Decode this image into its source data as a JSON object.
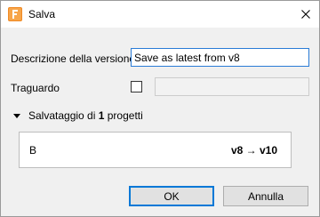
{
  "window": {
    "title": "Salva",
    "icon": "fusion-app-icon",
    "close_icon": "close-icon"
  },
  "form": {
    "description_label": "Descrizione della versione",
    "description_value": "Save as latest from v8",
    "milestone_label": "Traguardo",
    "milestone_checked": false,
    "milestone_value": ""
  },
  "section": {
    "prefix": "Salvataggio di ",
    "count": "1",
    "suffix": " progetti",
    "expanded": true
  },
  "projects": [
    {
      "name": "B",
      "version": "v8 → v10"
    }
  ],
  "buttons": {
    "ok": "OK",
    "cancel": "Annulla"
  },
  "colors": {
    "accent": "#0078d7",
    "icon_orange": "#f08a24"
  }
}
